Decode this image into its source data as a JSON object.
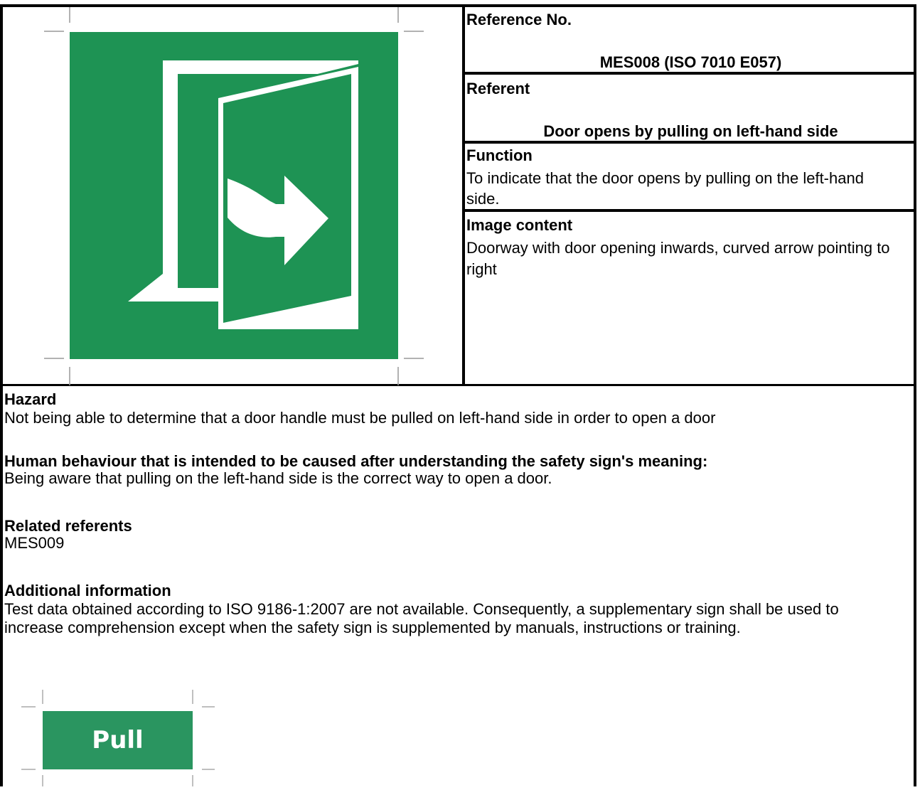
{
  "sign": {
    "icon": "door-opens-pull-left-icon",
    "color": "#1e9354"
  },
  "reference": {
    "label": "Reference No.",
    "value": "MES008 (ISO 7010 E057)"
  },
  "referent": {
    "label": "Referent",
    "value": "Door opens by pulling on left-hand side"
  },
  "function": {
    "label": "Function",
    "text": "To indicate that the door opens by pulling on the left-hand side."
  },
  "image_content": {
    "label": "Image content",
    "text": "Doorway with door opening inwards, curved arrow pointing to right"
  },
  "hazard": {
    "label": "Hazard",
    "text": "Not being able to determine that a door handle must be pulled on left-hand side in order to open a door"
  },
  "behaviour": {
    "label": "Human behaviour that is intended to be caused after understanding the safety sign's meaning:",
    "text": "Being aware that pulling on the left-hand side is the correct way to open a door."
  },
  "related": {
    "label": "Related referents",
    "text": "MES009"
  },
  "additional": {
    "label": "Additional information",
    "text": "Test data obtained according to ISO 9186-1:2007 are not available. Consequently, a supplementary sign shall be used to increase comprehension except when the safety sign is supplemented by manuals, instructions or training."
  },
  "supplementary_sign": {
    "label": "Pull",
    "color": "#2a9560"
  }
}
